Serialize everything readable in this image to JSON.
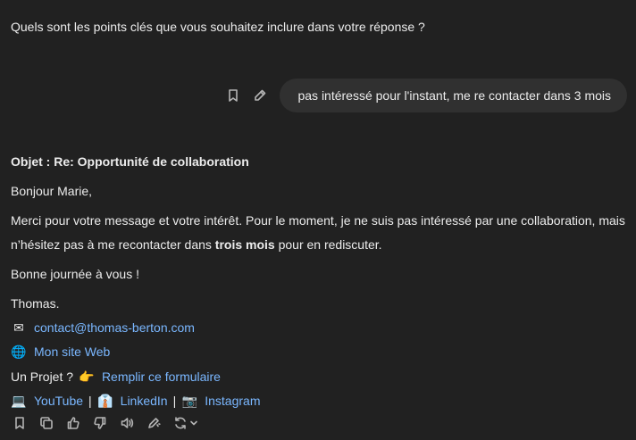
{
  "question": "Quels sont les points clés que vous souhaitez inclure dans votre réponse ?",
  "user_message": "pas intéressé pour l'instant, me re contacter dans 3 mois",
  "reply": {
    "subject": "Objet : Re: Opportunité de collaboration",
    "greeting": "Bonjour Marie,",
    "body_part1": "Merci pour votre message et votre intérêt. Pour le moment, je ne suis pas intéressé par une collaboration, mais n’hésitez pas à me recontacter dans ",
    "body_bold": "trois mois",
    "body_part2": " pour en rediscuter.",
    "closing": "Bonne journée à vous !",
    "signature_name": "Thomas.",
    "email": "contact@thomas-berton.com",
    "website": "Mon site Web",
    "project_prefix": "Un Projet ?",
    "form_link": "Remplir ce formulaire",
    "youtube": "YouTube",
    "linkedin": "LinkedIn",
    "instagram": "Instagram",
    "separator": "|"
  },
  "emojis": {
    "email": "✉",
    "web": "🌐",
    "point": "👉",
    "youtube": "💻",
    "linkedin": "👔",
    "instagram": "📷"
  },
  "icons": {
    "user_actions": [
      "bookmark-icon",
      "edit-icon"
    ],
    "toolbar": [
      "bookmark-icon",
      "copy-icon",
      "thumbs-up-icon",
      "thumbs-down-icon",
      "read-aloud-icon",
      "edit-pen-icon",
      "regenerate-icon",
      "chevron-down-icon"
    ]
  },
  "colors": {
    "background": "#212121",
    "bubble": "#303030",
    "text": "#ececec",
    "link": "#7ab7ff",
    "icon": "#b4b4b4"
  }
}
